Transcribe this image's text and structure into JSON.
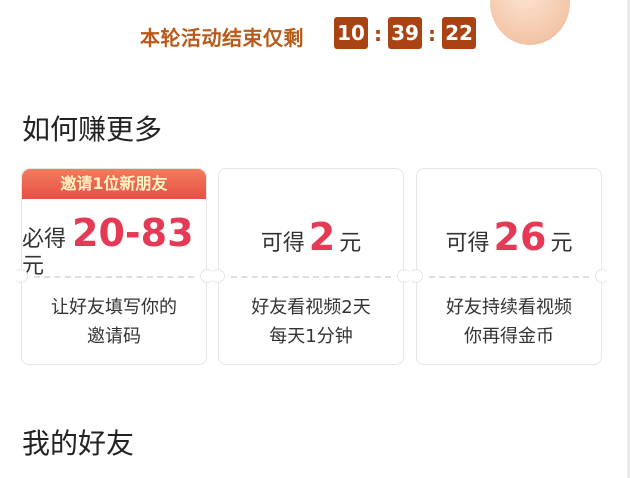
{
  "countdown": {
    "label": "本轮活动结束仅剩",
    "hours": "10",
    "minutes": "39",
    "seconds": "22",
    "separator": ":"
  },
  "how_to_earn": {
    "title": "如何赚更多",
    "cards": [
      {
        "badge": "邀请1位新朋友",
        "prefix": "必得",
        "amount": "20-83",
        "suffix": "元",
        "desc_line1": "让好友填写你的",
        "desc_line2": "邀请码"
      },
      {
        "prefix": "可得",
        "amount": "2",
        "suffix": "元",
        "desc_line1": "好友看视频2天",
        "desc_line2": "每天1分钟"
      },
      {
        "prefix": "可得",
        "amount": "26",
        "suffix": "元",
        "desc_line1": "好友持续看视频",
        "desc_line2": "你再得金币"
      }
    ]
  },
  "my_friends": {
    "title": "我的好友"
  },
  "colors": {
    "countdown_box": "#a94314",
    "countdown_label": "#b85a1a",
    "amount": "#e43a55",
    "badge_gradient_top": "#f07d5d",
    "badge_gradient_bottom": "#e94e45"
  }
}
